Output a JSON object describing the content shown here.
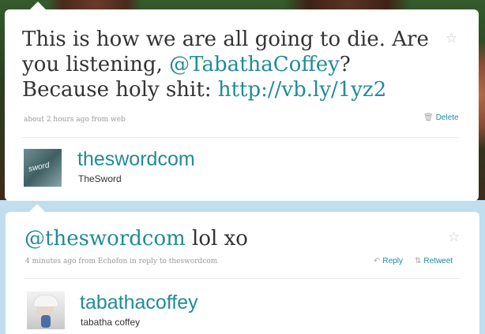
{
  "tweets": [
    {
      "text_before": "This is how we are all going to die. Are you listening, ",
      "mention": "@TabathaCoffey",
      "text_middle": "? Because holy shit: ",
      "url": "http://vb.ly/1yz2",
      "meta": "about 2 hours ago from web",
      "delete_label": "Delete",
      "screen_name": "theswordcom",
      "full_name": "TheSword",
      "avatar_text": "sword"
    },
    {
      "mention": "@theswordcom",
      "text_after": " lol xo",
      "meta": "4 minutes ago from Echofon in reply to theswordcom",
      "reply_label": "Reply",
      "retweet_label": "Retweet",
      "screen_name": "tabathacoffey",
      "full_name": "tabatha coffey"
    }
  ],
  "icons": {
    "favorite": "star-icon",
    "delete": "trash-icon",
    "reply": "reply-arrow-icon",
    "retweet": "retweet-icon"
  },
  "colors": {
    "link": "#1f8c99",
    "meta": "#999999",
    "text": "#333333",
    "page_bg": "#c0deed"
  }
}
